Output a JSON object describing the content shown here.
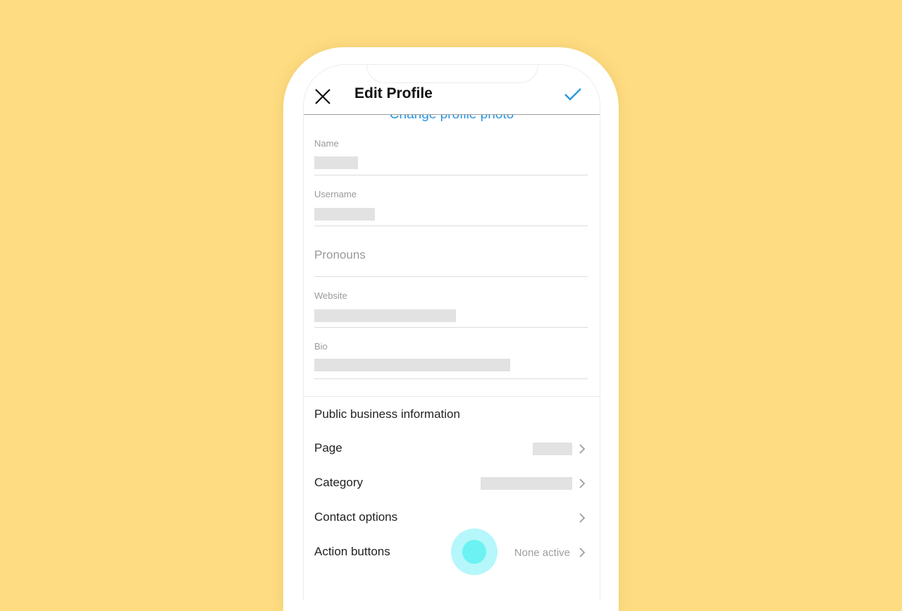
{
  "header": {
    "title": "Edit Profile",
    "close_icon": "close-icon",
    "confirm_icon": "checkmark-icon",
    "accent_color": "#2a96e0"
  },
  "profile": {
    "change_photo_label": "Change profile photo"
  },
  "fields": {
    "name": {
      "label": "Name",
      "value": "[redacted]"
    },
    "username": {
      "label": "Username",
      "value": "[redacted]"
    },
    "pronouns": {
      "placeholder": "Pronouns"
    },
    "website": {
      "label": "Website",
      "value": "[redacted]"
    },
    "bio": {
      "label": "Bio",
      "value": "[redacted]"
    }
  },
  "business": {
    "section_title": "Public business information",
    "rows": [
      {
        "label": "Page",
        "value": "[redacted]"
      },
      {
        "label": "Category",
        "value": "[redacted]"
      },
      {
        "label": "Contact options",
        "value": ""
      },
      {
        "label": "Action buttons",
        "value": "None active"
      }
    ]
  },
  "colors": {
    "background": "#fedc82",
    "touch_indicator": "#6cf2f2"
  }
}
